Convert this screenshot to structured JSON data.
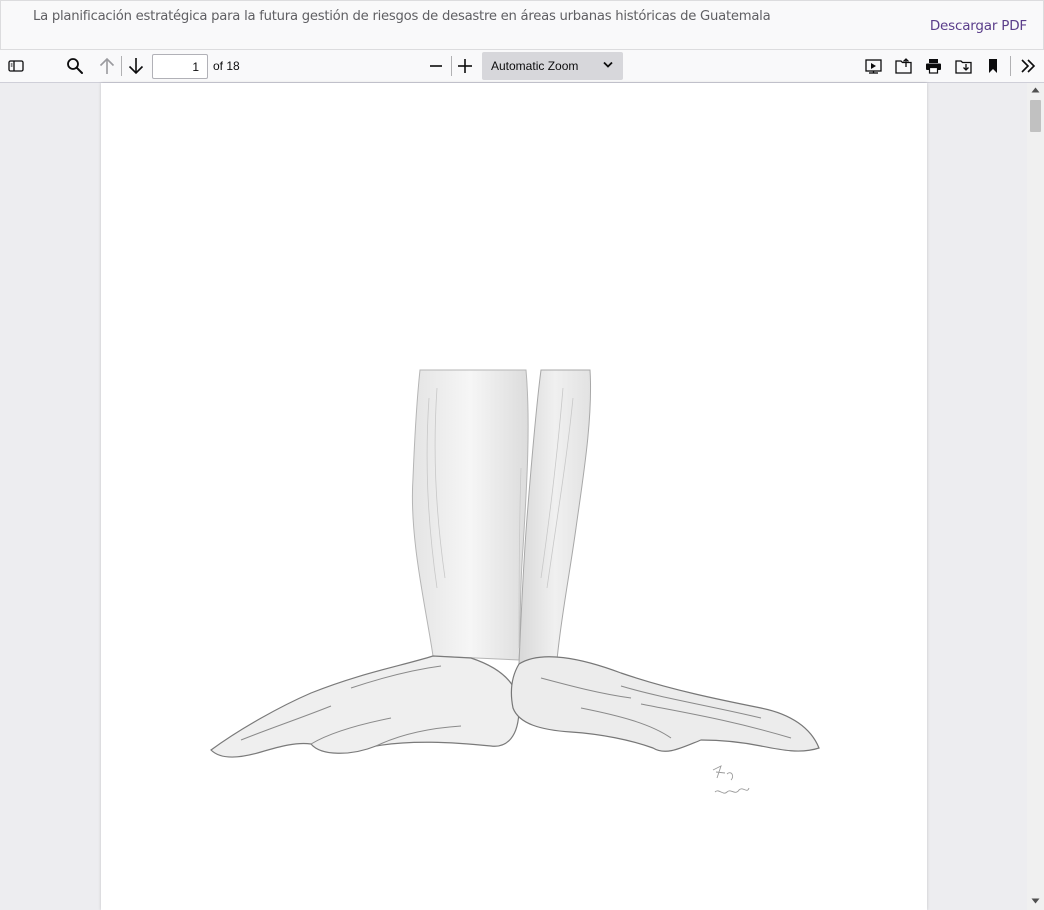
{
  "document": {
    "title": "La planificación estratégica para la futura gestión de riesgos de desastre en áreas urbanas históricas de Guatemala",
    "download_label": "Descargar PDF"
  },
  "toolbar": {
    "page_number": "1",
    "page_count_label": "of 18",
    "zoom_label": "Automatic Zoom",
    "icons": [
      "sidebar-toggle-icon",
      "search-icon",
      "arrow-up-icon",
      "arrow-down-icon",
      "zoom-out-icon",
      "zoom-in-icon",
      "presentation-icon",
      "open-file-icon",
      "print-icon",
      "download-icon",
      "bookmark-icon",
      "double-chevron-right-icon"
    ]
  },
  "colors": {
    "download_link": "#5a3d8a",
    "toolbar_bg": "#f9f9fa",
    "viewer_bg": "#ededf0",
    "zoom_select_bg": "#d7d7db"
  }
}
